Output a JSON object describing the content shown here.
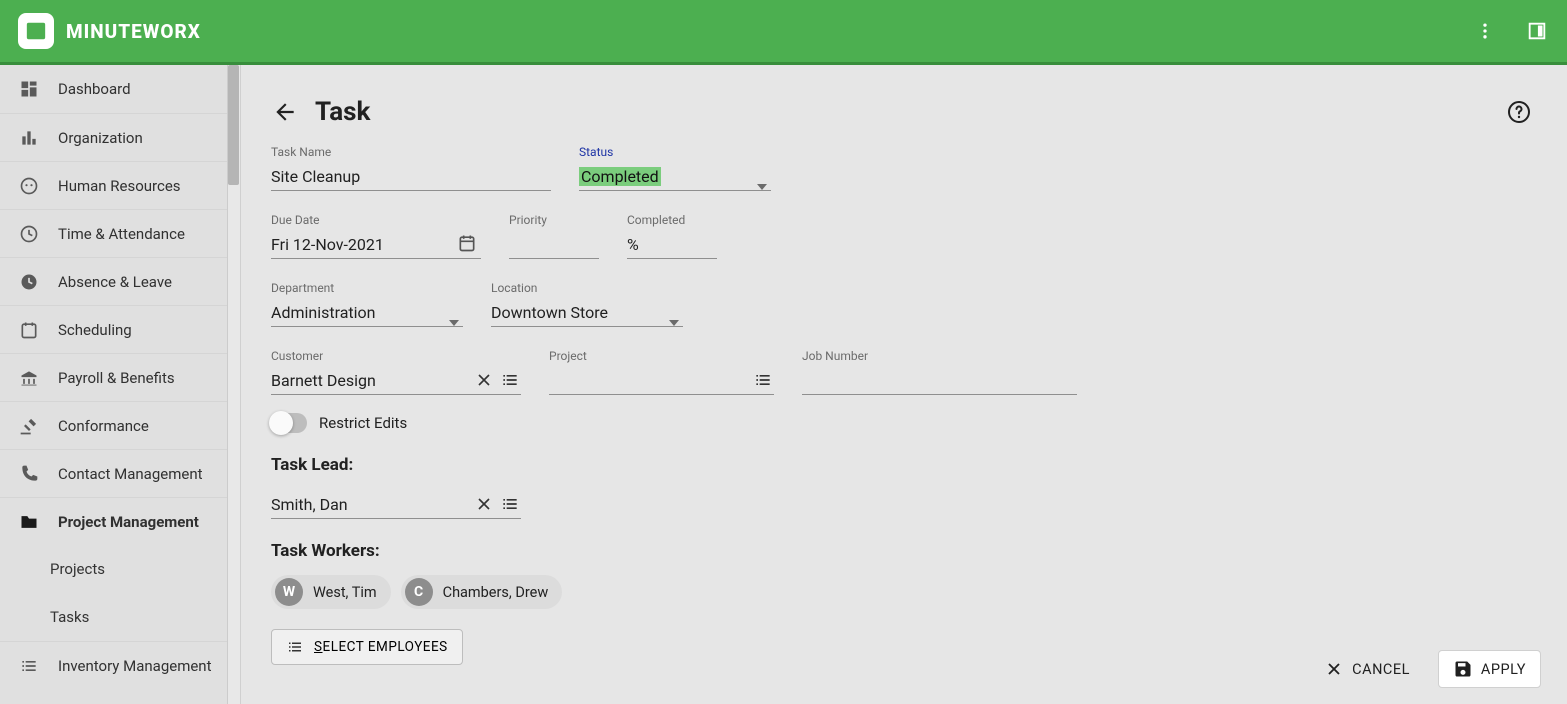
{
  "brand": {
    "name": "MINUTEWORX"
  },
  "sidebar": {
    "items": [
      {
        "label": "Dashboard"
      },
      {
        "label": "Organization"
      },
      {
        "label": "Human Resources"
      },
      {
        "label": "Time & Attendance"
      },
      {
        "label": "Absence & Leave"
      },
      {
        "label": "Scheduling"
      },
      {
        "label": "Payroll & Benefits"
      },
      {
        "label": "Conformance"
      },
      {
        "label": "Contact Management"
      },
      {
        "label": "Project Management"
      },
      {
        "label": "Inventory Management"
      }
    ],
    "sub": [
      {
        "label": "Projects"
      },
      {
        "label": "Tasks"
      }
    ]
  },
  "page": {
    "title": "Task"
  },
  "form": {
    "taskName": {
      "label": "Task Name",
      "value": "Site Cleanup"
    },
    "status": {
      "label": "Status",
      "value": "Completed"
    },
    "dueDate": {
      "label": "Due Date",
      "value": "Fri 12-Nov-2021"
    },
    "priority": {
      "label": "Priority",
      "value": ""
    },
    "completed": {
      "label": "Completed",
      "value": "%"
    },
    "department": {
      "label": "Department",
      "value": "Administration"
    },
    "location": {
      "label": "Location",
      "value": "Downtown Store"
    },
    "customer": {
      "label": "Customer",
      "value": "Barnett Design"
    },
    "project": {
      "label": "Project",
      "value": ""
    },
    "jobNumber": {
      "label": "Job Number",
      "value": ""
    },
    "restrict": {
      "label": "Restrict Edits"
    },
    "leadTitle": "Task Lead:",
    "lead": "Smith, Dan",
    "workersTitle": "Task Workers:",
    "workers": [
      {
        "initial": "W",
        "name": "West, Tim"
      },
      {
        "initial": "C",
        "name": "Chambers, Drew"
      }
    ],
    "selectEmployees": "SELECT EMPLOYEES"
  },
  "actions": {
    "cancel": "CANCEL",
    "apply": "APPLY"
  }
}
